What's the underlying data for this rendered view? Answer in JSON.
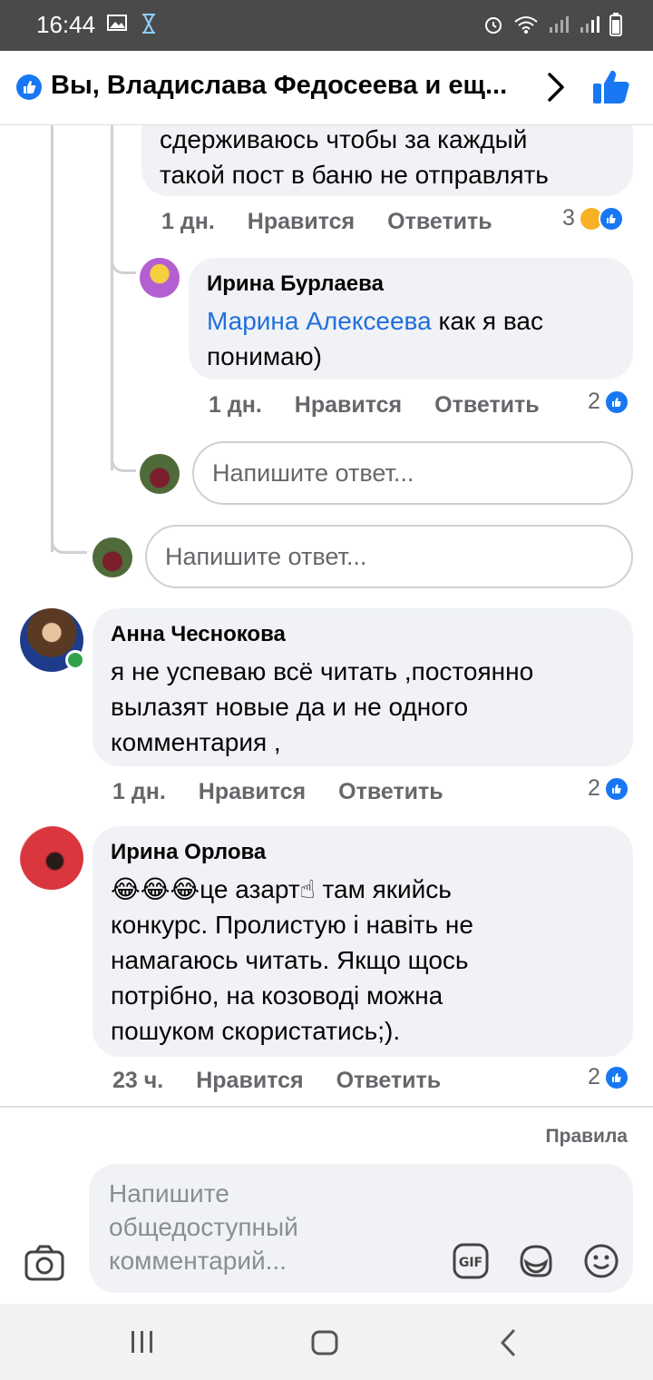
{
  "status_bar": {
    "time": "16:44"
  },
  "header": {
    "title": "Вы, Владислава Федосеева и ещ..."
  },
  "comments": [
    {
      "text": "сдерживаюсь чтобы за каждый\nтакой пост в баню не отправлять",
      "time": "1 дн.",
      "like_label": "Нравится",
      "reply_label": "Ответить",
      "reaction_count": "3"
    },
    {
      "author": "Ирина Бурлаева",
      "mention": "Марина Алексеева",
      "text": " как я вас\nпонимаю)",
      "time": "1 дн.",
      "like_label": "Нравится",
      "reply_label": "Ответить",
      "reaction_count": "2"
    },
    {
      "author": "Анна Чеснокова",
      "text": "я не успеваю всё читать ,постоянно\nвылазят новые  да и не одного\nкомментария ,",
      "time": "1 дн.",
      "like_label": "Нравится",
      "reply_label": "Ответить",
      "reaction_count": "2"
    },
    {
      "author": "Ирина Орлова",
      "text": "😂😂😂це азарт☝ там якийсь\nконкурс. Пролистую і навіть не\nнамагаюсь читать. Якщо щось\nпотрібно, на козоводі можна\nпошуком скористатись;).",
      "time": "23 ч.",
      "like_label": "Нравится",
      "reply_label": "Ответить",
      "reaction_count": "2"
    }
  ],
  "reply_inputs": {
    "placeholder": "Напишите ответ..."
  },
  "footer": {
    "rules_label": "Правила",
    "compose_placeholder": "Напишите\nобщедоступный\nкомментарий..."
  },
  "colors": {
    "brand": "#1877f2",
    "mention": "#216fdb",
    "bubble": "#f0f2f5",
    "meta": "#65676b",
    "online": "#31a24c"
  }
}
